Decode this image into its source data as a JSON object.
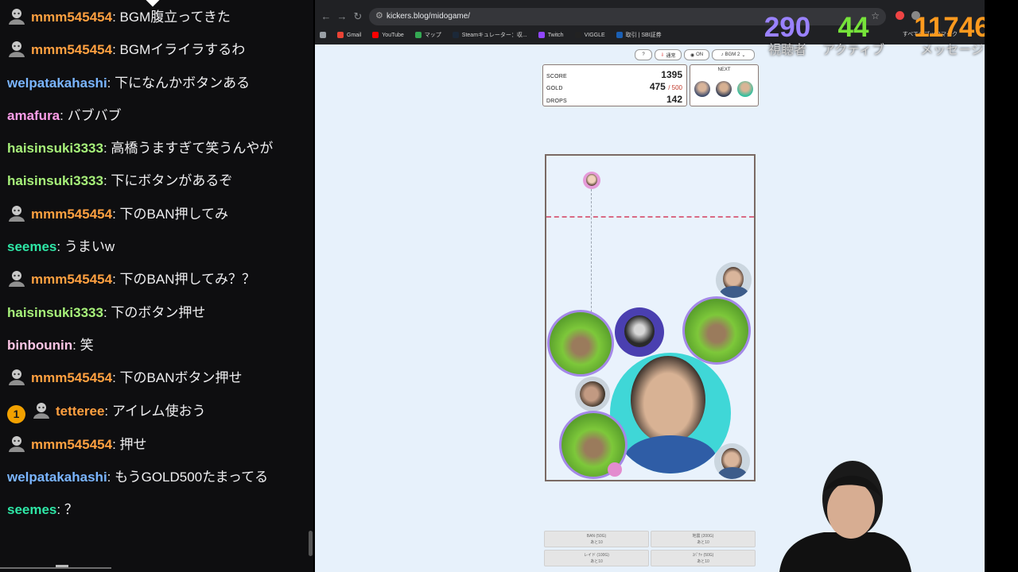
{
  "chat": {
    "messages": [
      {
        "user": "mmm545454",
        "user_color": "#ffa040",
        "avatar": true,
        "text": "BGM腹立ってきた"
      },
      {
        "user": "mmm545454",
        "user_color": "#ffa040",
        "avatar": true,
        "text": "BGMイライラするわ"
      },
      {
        "user": "welpatakahashi",
        "user_color": "#7ab5ff",
        "avatar": false,
        "text": "下になんかボタンある"
      },
      {
        "user": "amafura",
        "user_color": "#ff9eea",
        "avatar": false,
        "text": "バブバブ"
      },
      {
        "user": "haisinsuki3333",
        "user_color": "#a7f27a",
        "avatar": false,
        "text": "高橋うますぎて笑うんやが"
      },
      {
        "user": "haisinsuki3333",
        "user_color": "#a7f27a",
        "avatar": false,
        "text": "下にボタンがあるぞ"
      },
      {
        "user": "mmm545454",
        "user_color": "#ffa040",
        "avatar": true,
        "text": "下のBAN押してみ"
      },
      {
        "user": "seemes",
        "user_color": "#2ee6a6",
        "avatar": false,
        "text": "うまいw"
      },
      {
        "user": "mmm545454",
        "user_color": "#ffa040",
        "avatar": true,
        "text": "下のBAN押してみ？？"
      },
      {
        "user": "haisinsuki3333",
        "user_color": "#a7f27a",
        "avatar": false,
        "text": "下のボタン押せ"
      },
      {
        "user": "binbounin",
        "user_color": "#ffc6e6",
        "avatar": false,
        "text": "笑"
      },
      {
        "user": "mmm545454",
        "user_color": "#ffa040",
        "avatar": true,
        "text": "下のBANボタン押せ"
      },
      {
        "user": "tetteree",
        "user_color": "#ffa040",
        "avatar": true,
        "rank": "1",
        "text": "アイレム使おう"
      },
      {
        "user": "mmm545454",
        "user_color": "#ffa040",
        "avatar": true,
        "text": "押せ"
      },
      {
        "user": "welpatakahashi",
        "user_color": "#7ab5ff",
        "avatar": false,
        "text": "もうGOLD500たまってる"
      },
      {
        "user": "seemes",
        "user_color": "#2ee6a6",
        "avatar": false,
        "text": "？"
      }
    ]
  },
  "browser": {
    "url": "kickers.blog/midogame/",
    "bookmarks": [
      "Gmail",
      "YouTube",
      "マップ",
      "Steamキュレーター：収...",
      "Twitch",
      "VIGGLE",
      "取引 | SBI証券"
    ],
    "other_bookmarks": "すべてのブックマーク"
  },
  "stats": {
    "viewers": {
      "value": "290",
      "label": "視聴者",
      "color": "#9a82ff"
    },
    "active": {
      "value": "44",
      "label": "アクティブ",
      "color": "#76e33a"
    },
    "messages": {
      "value": "11746",
      "label": "メッセージ",
      "color": "#ff9a1e"
    }
  },
  "game": {
    "top_buttons": {
      "help": "?",
      "mode": "通常",
      "sound": "ON",
      "bgm": "BGM 2"
    },
    "score": {
      "label": "SCORE",
      "value": "1395"
    },
    "gold": {
      "label": "GOLD",
      "value": "475",
      "max": "/ 500"
    },
    "drops": {
      "label": "DROPS",
      "value": "142"
    },
    "next_label": "NEXT",
    "bottom_buttons": [
      {
        "title": "BAN (50G)",
        "sub": "あと10"
      },
      {
        "title": "地震 (200G)",
        "sub": "あと10"
      },
      {
        "title": "レイド (100G)",
        "sub": "あと10"
      },
      {
        "title": "ｽﾊﾟﾁｬ (50G)",
        "sub": "あと10"
      }
    ]
  }
}
